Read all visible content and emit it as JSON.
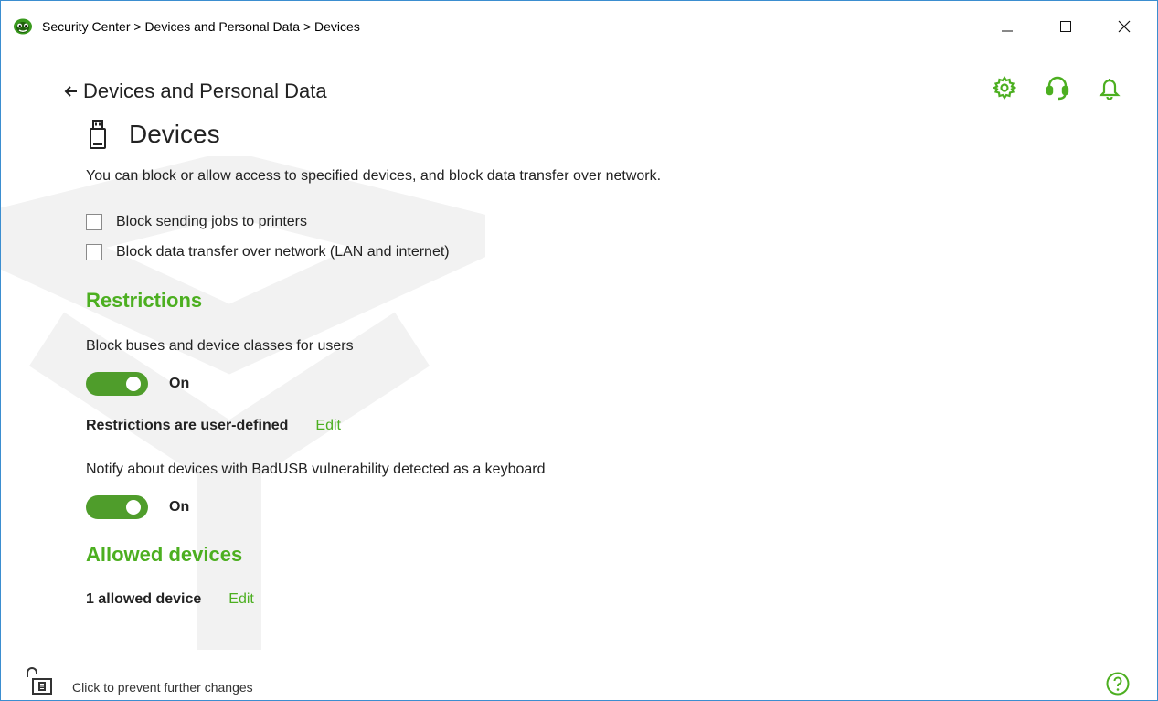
{
  "window": {
    "title": "Security Center > Devices and Personal Data > Devices"
  },
  "header": {
    "back_label": "Devices and Personal Data",
    "icons": [
      "gear-icon",
      "support-headset-icon",
      "bell-icon"
    ]
  },
  "page": {
    "title": "Devices",
    "description": "You can block or allow access to specified devices, and block data transfer over network."
  },
  "checkboxes": [
    {
      "label": "Block sending jobs to printers",
      "checked": false
    },
    {
      "label": "Block data transfer over network (LAN and internet)",
      "checked": false
    }
  ],
  "restrictions": {
    "title": "Restrictions",
    "block_label": "Block buses and device classes for users",
    "block_toggle_label": "On",
    "status": "Restrictions are user-defined",
    "edit_label": "Edit",
    "badusb_label": "Notify about devices with BadUSB vulnerability detected as a keyboard",
    "badusb_toggle_label": "On"
  },
  "allowed": {
    "title": "Allowed devices",
    "count_text": "1 allowed device",
    "edit_label": "Edit"
  },
  "footer": {
    "lock_text": "Click to prevent further changes"
  },
  "colors": {
    "accent": "#4caf20",
    "toggle_on": "#4f9d2b",
    "window_border": "#3b8ed0"
  }
}
